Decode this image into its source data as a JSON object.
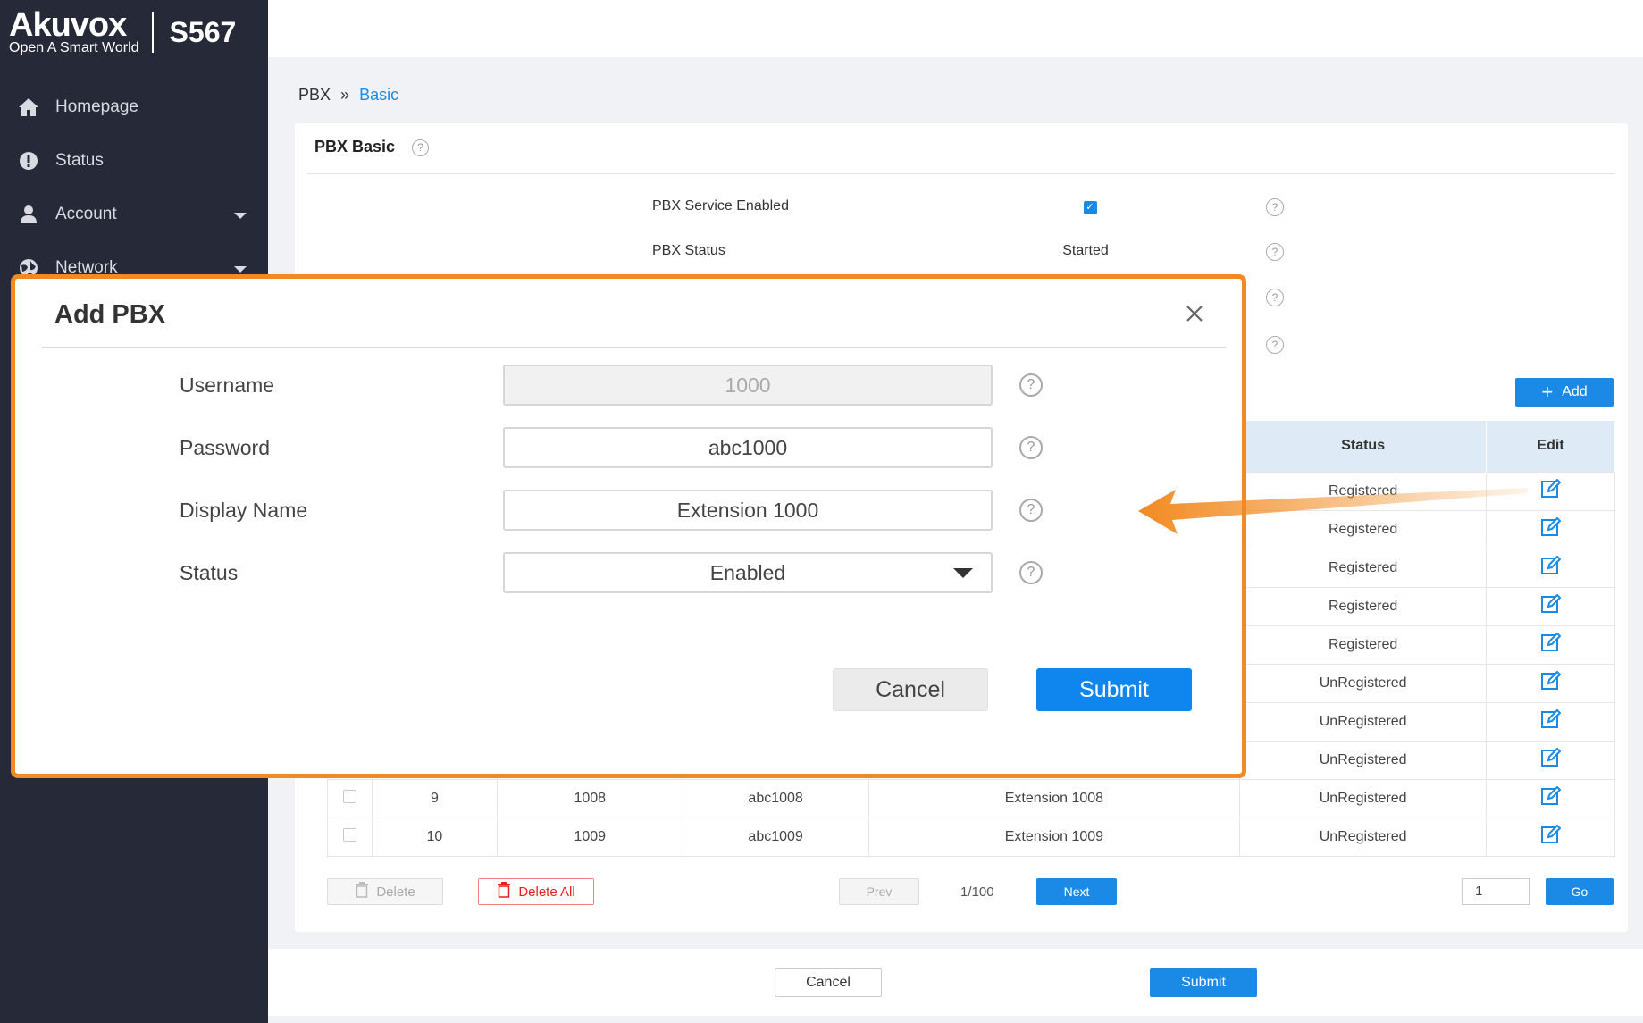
{
  "brand": {
    "logo": "Akuvox",
    "tagline": "Open A Smart World",
    "model": "S567"
  },
  "nav": [
    {
      "label": "Homepage",
      "icon": "home-icon",
      "caret": false
    },
    {
      "label": "Status",
      "icon": "info-icon",
      "caret": false
    },
    {
      "label": "Account",
      "icon": "user-icon",
      "caret": true
    },
    {
      "label": "Network",
      "icon": "network-icon",
      "caret": true
    }
  ],
  "breadcrumb": {
    "root": "PBX",
    "separator": "»",
    "current": "Basic"
  },
  "panel": {
    "title": "PBX Basic",
    "service_enabled_label": "PBX Service Enabled",
    "status_label": "PBX Status",
    "status_value": "Started",
    "add_label": "Add"
  },
  "table": {
    "columns": {
      "status": "Status",
      "edit": "Edit"
    },
    "status_rows": [
      "Registered",
      "Registered",
      "Registered",
      "Registered",
      "Registered",
      "UnRegistered",
      "UnRegistered",
      "UnRegistered"
    ],
    "rows": [
      {
        "index": "9",
        "username": "1008",
        "password": "abc1008",
        "display": "Extension 1008",
        "status": "UnRegistered"
      },
      {
        "index": "10",
        "username": "1009",
        "password": "abc1009",
        "display": "Extension 1009",
        "status": "UnRegistered"
      }
    ]
  },
  "pager": {
    "delete": "Delete",
    "delete_all": "Delete All",
    "prev": "Prev",
    "page": "1/100",
    "next": "Next",
    "page_input": "1",
    "go": "Go"
  },
  "footer": {
    "cancel": "Cancel",
    "submit": "Submit"
  },
  "modal": {
    "title": "Add PBX",
    "username_label": "Username",
    "username_value": "1000",
    "password_label": "Password",
    "password_value": "abc1000",
    "display_label": "Display Name",
    "display_value": "Extension 1000",
    "status_label": "Status",
    "status_value": "Enabled",
    "cancel": "Cancel",
    "submit": "Submit"
  },
  "colors": {
    "accent": "#1a8ae6",
    "highlight": "#f28a21",
    "sidebar": "#252938",
    "unregistered": "#e61f1f"
  }
}
